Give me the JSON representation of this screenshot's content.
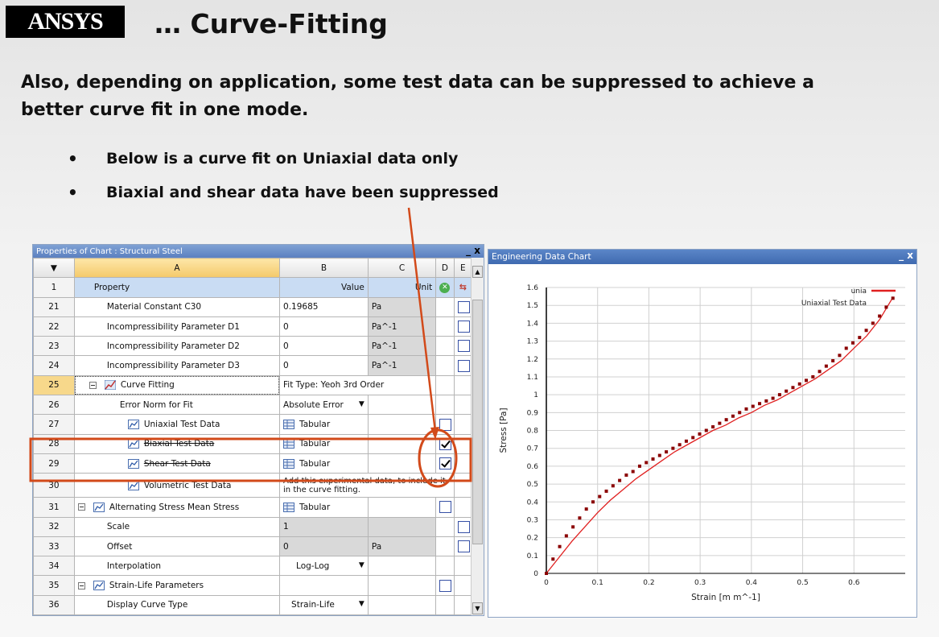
{
  "logo": {
    "brand": "ANSYS"
  },
  "slide": {
    "title": "… Curve-Fitting",
    "intro": "Also, depending on application, some test data can be suppressed to achieve a better curve fit in one mode.",
    "bullets": [
      "Below is a curve fit on Uniaxial data only",
      "Biaxial and shear data have been suppressed"
    ]
  },
  "properties_window": {
    "title": "Properties of Chart : Structural Steel",
    "window_buttons": "_ x",
    "columns": [
      "A",
      "B",
      "C",
      "D",
      "E"
    ],
    "header_row": {
      "num": "1",
      "property": "Property",
      "value": "Value",
      "unit": "Unit"
    },
    "rows": [
      {
        "num": "21",
        "property": "Material Constant C30",
        "value": "0.19685",
        "unit": "Pa"
      },
      {
        "num": "22",
        "property": "Incompressibility Parameter D1",
        "value": "0",
        "unit": "Pa^-1"
      },
      {
        "num": "23",
        "property": "Incompressibility Parameter D2",
        "value": "0",
        "unit": "Pa^-1"
      },
      {
        "num": "24",
        "property": "Incompressibility Parameter D3",
        "value": "0",
        "unit": "Pa^-1"
      },
      {
        "num": "25",
        "property": "Curve Fitting",
        "value": "Fit Type: Yeoh 3rd Order"
      },
      {
        "num": "26",
        "property": "Error Norm for Fit",
        "value": "Absolute Error"
      },
      {
        "num": "27",
        "property": "Uniaxial Test Data",
        "value": "Tabular"
      },
      {
        "num": "28",
        "property": "Biaxial Test Data",
        "value": "Tabular"
      },
      {
        "num": "29",
        "property": "Shear Test Data",
        "value": "Tabular"
      },
      {
        "num": "30",
        "property": "Volumetric Test Data",
        "value": "Add this experimental data, to include it",
        "value2": "in the curve fitting."
      },
      {
        "num": "31",
        "property": "Alternating Stress Mean Stress",
        "value": "Tabular"
      },
      {
        "num": "32",
        "property": "Scale",
        "value": "1"
      },
      {
        "num": "33",
        "property": "Offset",
        "value": "0",
        "unit": "Pa"
      },
      {
        "num": "34",
        "property": "Interpolation",
        "value": "Log-Log"
      },
      {
        "num": "35",
        "property": "Strain-Life Parameters",
        "value": ""
      },
      {
        "num": "36",
        "property": "Display Curve Type",
        "value": "Strain-Life"
      }
    ],
    "accent": "#d24a1a"
  },
  "chart_window": {
    "title": "Engineering Data Chart",
    "window_buttons": "_ x"
  },
  "chart_data": {
    "type": "line",
    "xlabel": "Strain  [m m^-1]",
    "ylabel": "Stress  [Pa]",
    "xlim": [
      0,
      0.7
    ],
    "ylim": [
      0,
      1.6
    ],
    "x_ticks": [
      "0",
      "0.1",
      "0.2",
      "0.3",
      "0.4",
      "0.5",
      "0.6"
    ],
    "y_ticks": [
      "0",
      "0.1",
      "0.2",
      "0.3",
      "0.4",
      "0.5",
      "0.6",
      "0.7",
      "0.8",
      "0.9",
      "1",
      "1.1",
      "1.2",
      "1.3",
      "1.4",
      "1.5",
      "1.6"
    ],
    "grid": true,
    "legend_position": "top-right",
    "series": [
      {
        "name": "Uniaxial Test Data",
        "style": "dots",
        "color": "#8b0000",
        "x": [
          0,
          0.013,
          0.026,
          0.039,
          0.052,
          0.065,
          0.078,
          0.091,
          0.104,
          0.117,
          0.13,
          0.143,
          0.156,
          0.169,
          0.182,
          0.195,
          0.208,
          0.221,
          0.234,
          0.247,
          0.26,
          0.273,
          0.286,
          0.299,
          0.312,
          0.325,
          0.338,
          0.351,
          0.364,
          0.377,
          0.39,
          0.403,
          0.416,
          0.429,
          0.442,
          0.455,
          0.468,
          0.481,
          0.494,
          0.507,
          0.52,
          0.533,
          0.546,
          0.559,
          0.572,
          0.585,
          0.598,
          0.611,
          0.624,
          0.637,
          0.65,
          0.663,
          0.676
        ],
        "y": [
          0,
          0.08,
          0.15,
          0.21,
          0.26,
          0.31,
          0.36,
          0.4,
          0.43,
          0.46,
          0.49,
          0.52,
          0.55,
          0.57,
          0.6,
          0.62,
          0.64,
          0.66,
          0.68,
          0.7,
          0.72,
          0.74,
          0.76,
          0.78,
          0.8,
          0.82,
          0.84,
          0.86,
          0.88,
          0.9,
          0.92,
          0.935,
          0.95,
          0.965,
          0.98,
          1.0,
          1.02,
          1.04,
          1.06,
          1.08,
          1.1,
          1.13,
          1.16,
          1.19,
          1.22,
          1.26,
          1.29,
          1.32,
          1.36,
          1.4,
          1.44,
          1.49,
          1.54
        ]
      },
      {
        "name": "unia",
        "style": "line",
        "color": "#e02020",
        "x": [
          0,
          0.025,
          0.05,
          0.075,
          0.1,
          0.125,
          0.15,
          0.175,
          0.2,
          0.225,
          0.25,
          0.275,
          0.3,
          0.325,
          0.35,
          0.375,
          0.4,
          0.425,
          0.45,
          0.475,
          0.5,
          0.525,
          0.55,
          0.575,
          0.6,
          0.625,
          0.65,
          0.675
        ],
        "y": [
          0,
          0.09,
          0.18,
          0.26,
          0.34,
          0.41,
          0.47,
          0.53,
          0.58,
          0.63,
          0.68,
          0.72,
          0.76,
          0.8,
          0.83,
          0.87,
          0.9,
          0.94,
          0.97,
          1.01,
          1.05,
          1.09,
          1.14,
          1.19,
          1.26,
          1.33,
          1.42,
          1.54
        ]
      }
    ]
  }
}
